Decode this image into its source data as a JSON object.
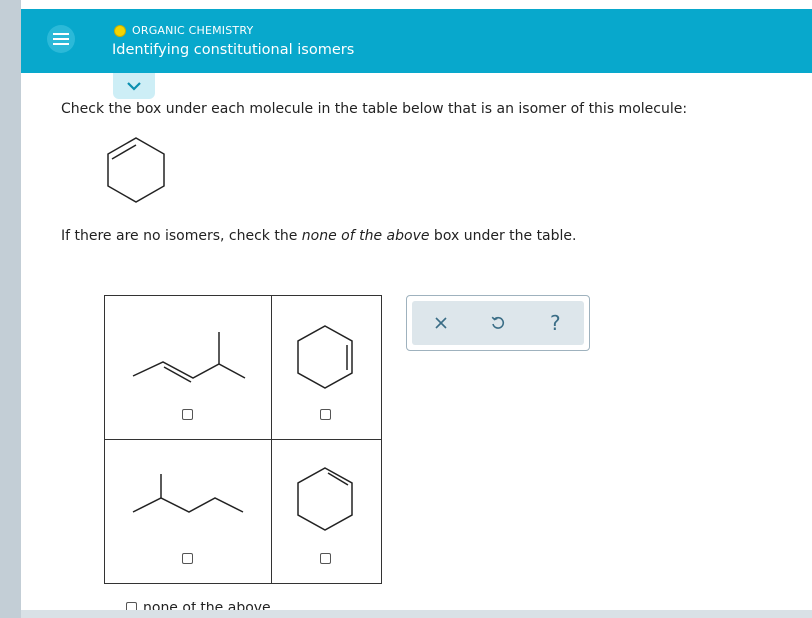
{
  "header": {
    "topic": "ORGANIC CHEMISTRY",
    "title": "Identifying constitutional isomers",
    "colors": {
      "bar": "#08a8cc",
      "topic_dot": "#f2d500"
    }
  },
  "question": {
    "instruction": "Check the box under each molecule in the table below that is an isomer of this molecule:",
    "note_prefix": "If there are no isomers, check the ",
    "note_emphasis": "none of the above",
    "note_suffix": " box under the table.",
    "target_molecule": "cyclohexene"
  },
  "table": {
    "molecules": [
      {
        "structure": "hexene-with-branch",
        "checked": false
      },
      {
        "structure": "cyclohexene",
        "checked": false
      },
      {
        "structure": "branched-alkane",
        "checked": false
      },
      {
        "structure": "cyclohexene",
        "checked": false
      }
    ],
    "none_of_above_label": "none of the above"
  },
  "toolbar": {
    "icons": [
      "close-icon",
      "undo-icon",
      "help-icon"
    ],
    "help_glyph": "?"
  }
}
